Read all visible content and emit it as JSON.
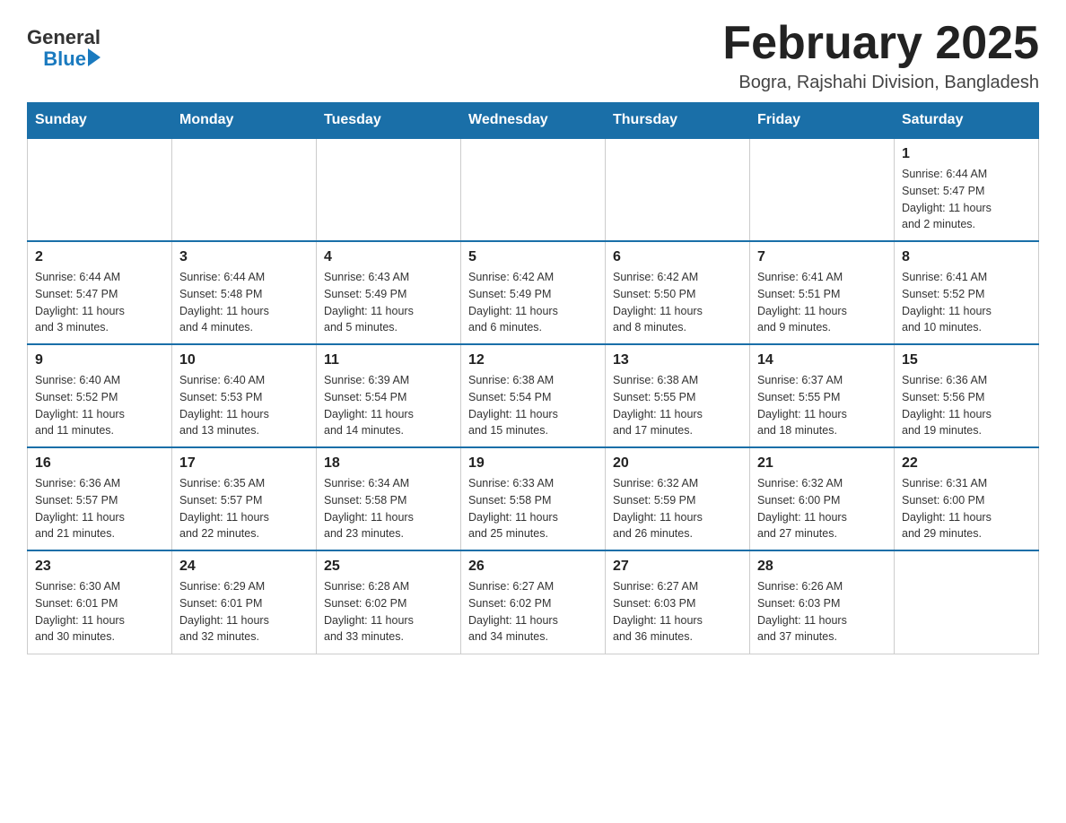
{
  "logo": {
    "text_general": "General",
    "text_blue": "Blue"
  },
  "title": "February 2025",
  "subtitle": "Bogra, Rajshahi Division, Bangladesh",
  "days_of_week": [
    "Sunday",
    "Monday",
    "Tuesday",
    "Wednesday",
    "Thursday",
    "Friday",
    "Saturday"
  ],
  "weeks": [
    [
      {
        "day": "",
        "info": ""
      },
      {
        "day": "",
        "info": ""
      },
      {
        "day": "",
        "info": ""
      },
      {
        "day": "",
        "info": ""
      },
      {
        "day": "",
        "info": ""
      },
      {
        "day": "",
        "info": ""
      },
      {
        "day": "1",
        "info": "Sunrise: 6:44 AM\nSunset: 5:47 PM\nDaylight: 11 hours\nand 2 minutes."
      }
    ],
    [
      {
        "day": "2",
        "info": "Sunrise: 6:44 AM\nSunset: 5:47 PM\nDaylight: 11 hours\nand 3 minutes."
      },
      {
        "day": "3",
        "info": "Sunrise: 6:44 AM\nSunset: 5:48 PM\nDaylight: 11 hours\nand 4 minutes."
      },
      {
        "day": "4",
        "info": "Sunrise: 6:43 AM\nSunset: 5:49 PM\nDaylight: 11 hours\nand 5 minutes."
      },
      {
        "day": "5",
        "info": "Sunrise: 6:42 AM\nSunset: 5:49 PM\nDaylight: 11 hours\nand 6 minutes."
      },
      {
        "day": "6",
        "info": "Sunrise: 6:42 AM\nSunset: 5:50 PM\nDaylight: 11 hours\nand 8 minutes."
      },
      {
        "day": "7",
        "info": "Sunrise: 6:41 AM\nSunset: 5:51 PM\nDaylight: 11 hours\nand 9 minutes."
      },
      {
        "day": "8",
        "info": "Sunrise: 6:41 AM\nSunset: 5:52 PM\nDaylight: 11 hours\nand 10 minutes."
      }
    ],
    [
      {
        "day": "9",
        "info": "Sunrise: 6:40 AM\nSunset: 5:52 PM\nDaylight: 11 hours\nand 11 minutes."
      },
      {
        "day": "10",
        "info": "Sunrise: 6:40 AM\nSunset: 5:53 PM\nDaylight: 11 hours\nand 13 minutes."
      },
      {
        "day": "11",
        "info": "Sunrise: 6:39 AM\nSunset: 5:54 PM\nDaylight: 11 hours\nand 14 minutes."
      },
      {
        "day": "12",
        "info": "Sunrise: 6:38 AM\nSunset: 5:54 PM\nDaylight: 11 hours\nand 15 minutes."
      },
      {
        "day": "13",
        "info": "Sunrise: 6:38 AM\nSunset: 5:55 PM\nDaylight: 11 hours\nand 17 minutes."
      },
      {
        "day": "14",
        "info": "Sunrise: 6:37 AM\nSunset: 5:55 PM\nDaylight: 11 hours\nand 18 minutes."
      },
      {
        "day": "15",
        "info": "Sunrise: 6:36 AM\nSunset: 5:56 PM\nDaylight: 11 hours\nand 19 minutes."
      }
    ],
    [
      {
        "day": "16",
        "info": "Sunrise: 6:36 AM\nSunset: 5:57 PM\nDaylight: 11 hours\nand 21 minutes."
      },
      {
        "day": "17",
        "info": "Sunrise: 6:35 AM\nSunset: 5:57 PM\nDaylight: 11 hours\nand 22 minutes."
      },
      {
        "day": "18",
        "info": "Sunrise: 6:34 AM\nSunset: 5:58 PM\nDaylight: 11 hours\nand 23 minutes."
      },
      {
        "day": "19",
        "info": "Sunrise: 6:33 AM\nSunset: 5:58 PM\nDaylight: 11 hours\nand 25 minutes."
      },
      {
        "day": "20",
        "info": "Sunrise: 6:32 AM\nSunset: 5:59 PM\nDaylight: 11 hours\nand 26 minutes."
      },
      {
        "day": "21",
        "info": "Sunrise: 6:32 AM\nSunset: 6:00 PM\nDaylight: 11 hours\nand 27 minutes."
      },
      {
        "day": "22",
        "info": "Sunrise: 6:31 AM\nSunset: 6:00 PM\nDaylight: 11 hours\nand 29 minutes."
      }
    ],
    [
      {
        "day": "23",
        "info": "Sunrise: 6:30 AM\nSunset: 6:01 PM\nDaylight: 11 hours\nand 30 minutes."
      },
      {
        "day": "24",
        "info": "Sunrise: 6:29 AM\nSunset: 6:01 PM\nDaylight: 11 hours\nand 32 minutes."
      },
      {
        "day": "25",
        "info": "Sunrise: 6:28 AM\nSunset: 6:02 PM\nDaylight: 11 hours\nand 33 minutes."
      },
      {
        "day": "26",
        "info": "Sunrise: 6:27 AM\nSunset: 6:02 PM\nDaylight: 11 hours\nand 34 minutes."
      },
      {
        "day": "27",
        "info": "Sunrise: 6:27 AM\nSunset: 6:03 PM\nDaylight: 11 hours\nand 36 minutes."
      },
      {
        "day": "28",
        "info": "Sunrise: 6:26 AM\nSunset: 6:03 PM\nDaylight: 11 hours\nand 37 minutes."
      },
      {
        "day": "",
        "info": ""
      }
    ]
  ]
}
